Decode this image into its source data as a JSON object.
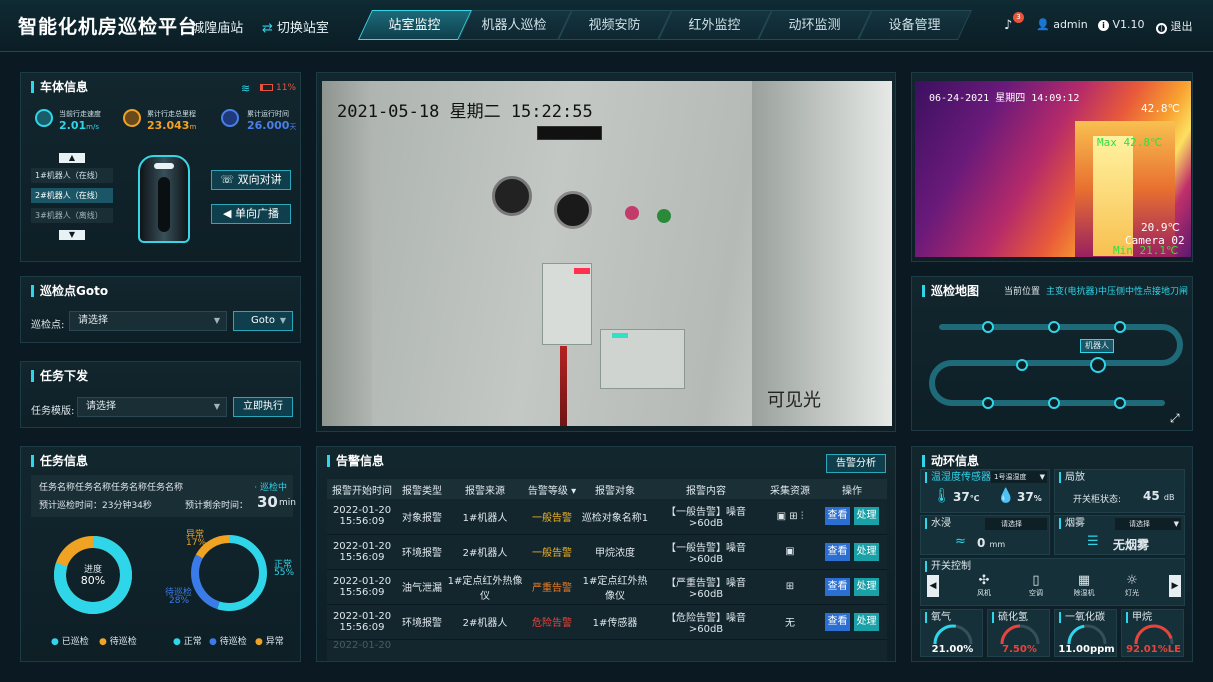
{
  "header": {
    "title": "智能化机房巡检平台",
    "station": "· 城隍庙站",
    "switch_label": "切换站室",
    "nav": [
      "站室监控",
      "机器人巡检",
      "视频安防",
      "红外监控",
      "动环监测",
      "设备管理"
    ],
    "bell_count": "3",
    "user": "admin",
    "version": "V1.10",
    "logout": "退出"
  },
  "vehicle": {
    "title": "车体信息",
    "battery": "11%",
    "speed_label": "当前行走速度",
    "speed_value": "2.01",
    "speed_unit": "m/s",
    "distance_label": "累计行走总里程",
    "distance_value": "23.043",
    "distance_unit": "m",
    "runtime_label": "累计运行时间",
    "runtime_value": "26.000",
    "runtime_unit": "天",
    "robots": [
      "1#机器人（在线）",
      "2#机器人（在线）",
      "3#机器人（离线）"
    ],
    "talk_btn": "双向对讲",
    "broadcast_btn": "单向广播"
  },
  "goto": {
    "title": "巡检点Goto",
    "label": "巡检点:",
    "select": "请选择",
    "btn": "Goto"
  },
  "task_dispatch": {
    "title": "任务下发",
    "label": "任务模版:",
    "select": "请选择",
    "btn": "立即执行"
  },
  "task_info": {
    "title": "任务信息",
    "name": "任务名称任务名称任务名称任务名称",
    "status": "· 巡检中",
    "est_time": "预计巡检时间：23分钟34秒",
    "remain_label": "预计剩余时间：",
    "remain_value": "30",
    "remain_unit": "min",
    "progress_label": "进度",
    "progress_value": "80%",
    "progress_fraction": 0.8,
    "legend1": [
      "已巡检",
      "待巡检"
    ],
    "abnormal_label": "异常",
    "abnormal_value": "17%",
    "normal_label": "正常",
    "normal_value": "55%",
    "pending_label": "待巡检",
    "pending_value": "28%",
    "legend2": [
      "正常",
      "待巡检",
      "异常"
    ]
  },
  "video": {
    "timestamp": "2021-05-18  星期二  15:22:55",
    "caption": "可见光"
  },
  "thermal": {
    "timestamp": "06-24-2021  星期四  14:09:12",
    "max_temp": "42.8℃",
    "max_label": "Max 42.8℃",
    "min_temp": "20.9℃",
    "camera": "Camera 02",
    "min_label": "Min 21.1℃"
  },
  "map": {
    "title": "巡检地图",
    "pos_label": "当前位置",
    "pos_value": "主变(电抗器)中压侧中性点接地刀闸",
    "robot_label": "机器人"
  },
  "alarms": {
    "title": "告警信息",
    "analysis_btn": "告警分析",
    "columns": [
      "报警开始时间",
      "报警类型",
      "报警来源",
      "告警等级",
      "报警对象",
      "报警内容",
      "采集资源",
      "操作"
    ],
    "rows": [
      {
        "date": "2022-01-20",
        "time": "15:56:09",
        "type": "对象报警",
        "source": "1#机器人",
        "level": "一般告警",
        "object": "巡检对象名称1",
        "content": "【一般告警】噪音>60dB",
        "res": "icons3"
      },
      {
        "date": "2022-01-20",
        "time": "15:56:09",
        "type": "环境报警",
        "source": "2#机器人",
        "level": "一般告警",
        "object": "甲烷浓度",
        "content": "【一般告警】噪音>60dB",
        "res": "icon1"
      },
      {
        "date": "2022-01-20",
        "time": "15:56:09",
        "type": "油气泄漏",
        "source": "1#定点红外热像仪",
        "level": "严重告警",
        "object": "1#定点红外热像仪",
        "content": "【严重告警】噪音>60dB",
        "res": "icon2"
      },
      {
        "date": "2022-01-20",
        "time": "15:56:09",
        "type": "环境报警",
        "source": "2#机器人",
        "level": "危险告警",
        "object": "1#传感器",
        "content": "【危险告警】噪音>60dB",
        "res": "无"
      }
    ],
    "partial_date": "2022-01-20",
    "look": "查看",
    "handle": "处理",
    "level_colors": {
      "一般告警": "#f0b323",
      "严重告警": "#f07d23",
      "危险告警": "#e8443b"
    }
  },
  "env": {
    "title": "动环信息",
    "th_title": "温湿度传感器",
    "th_select": "1号温湿度",
    "temp_value": "37",
    "temp_unit": "℃",
    "hum_value": "37",
    "hum_unit": "%",
    "discharge_title": "局放",
    "discharge_label": "开关柜状态:",
    "discharge_value": "45",
    "discharge_unit": "dB",
    "water_title": "水浸",
    "water_select": "请选择",
    "water_value": "0",
    "water_unit": "mm",
    "smoke_title": "烟雾",
    "smoke_select": "请选择",
    "smoke_value": "无烟雾",
    "switch_title": "开关控制",
    "switches": [
      "风机",
      "空调",
      "除湿机",
      "灯光"
    ],
    "gauges": [
      {
        "name": "氧气",
        "value": "21.00%",
        "color": "#2fd5e8",
        "fill": 0.55
      },
      {
        "name": "硫化氢",
        "value": "7.50%",
        "color": "#e8443b",
        "fill": 0.5
      },
      {
        "name": "一氧化碳",
        "value": "11.00ppm",
        "color": "#2fd5e8",
        "fill": 0.45
      },
      {
        "name": "甲烷",
        "value": "92.01%LE",
        "color": "#e8443b",
        "fill": 0.9
      }
    ]
  }
}
